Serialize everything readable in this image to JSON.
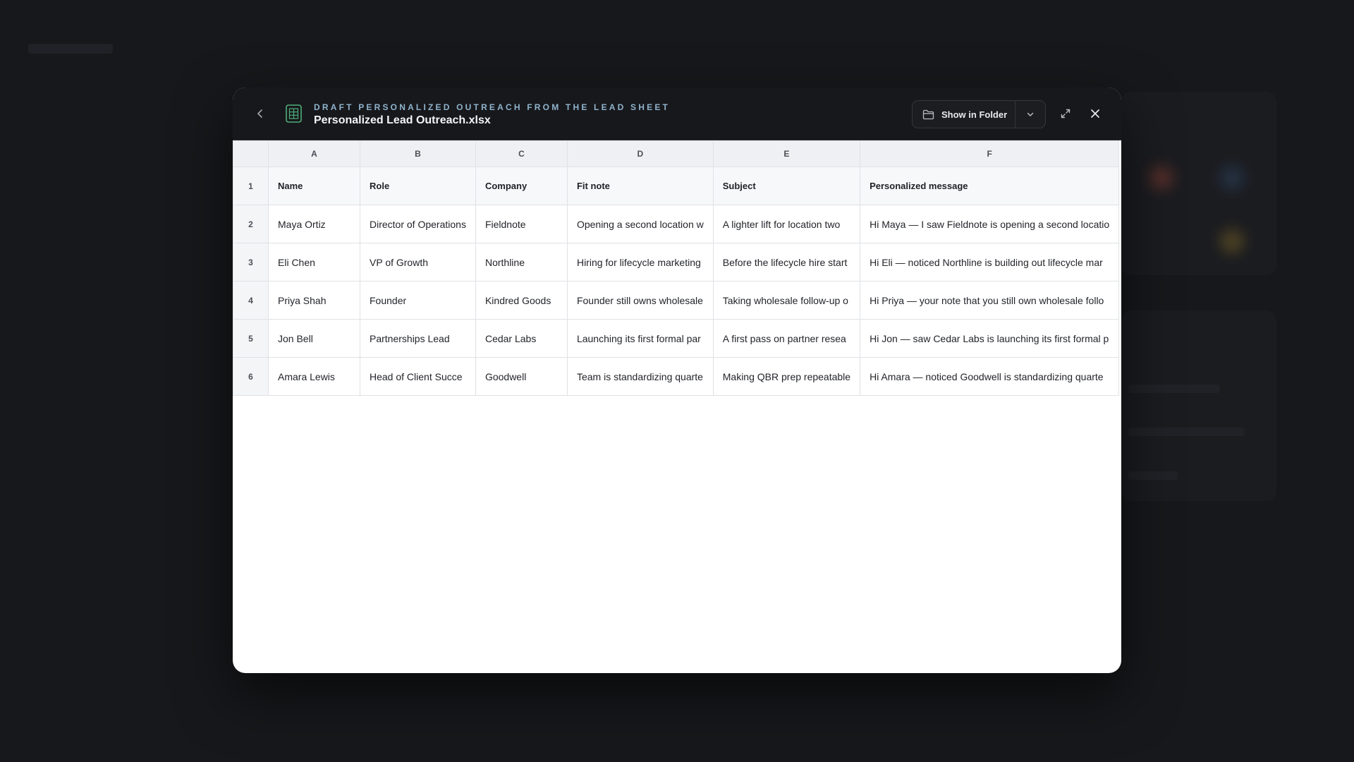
{
  "header": {
    "kicker": "DRAFT PERSONALIZED OUTREACH FROM THE LEAD SHEET",
    "title": "Personalized Lead Outreach.xlsx",
    "show_in_folder_label": "Show in Folder",
    "icons": {
      "back": "chevron-left-icon",
      "file": "spreadsheet-icon",
      "folder": "folder-icon",
      "dropdown": "chevron-down-icon",
      "expand": "expand-icon",
      "close": "close-icon"
    }
  },
  "sheet": {
    "column_letters": [
      "A",
      "B",
      "C",
      "D",
      "E",
      "F"
    ],
    "row_numbers": [
      "1",
      "2",
      "3",
      "4",
      "5",
      "6"
    ],
    "headers": [
      "Name",
      "Role",
      "Company",
      "Fit note",
      "Subject",
      "Personalized message"
    ],
    "rows": [
      [
        "Maya Ortiz",
        "Director of Operations",
        "Fieldnote",
        "Opening a second location w",
        "A lighter lift for location two",
        "Hi Maya — I saw Fieldnote is opening a second locatio"
      ],
      [
        "Eli Chen",
        "VP of Growth",
        "Northline",
        "Hiring for lifecycle marketing",
        "Before the lifecycle hire start",
        "Hi Eli — noticed Northline is building out lifecycle mar"
      ],
      [
        "Priya Shah",
        "Founder",
        "Kindred Goods",
        "Founder still owns wholesale",
        "Taking wholesale follow-up o",
        "Hi Priya — your note that you still own wholesale follo"
      ],
      [
        "Jon Bell",
        "Partnerships Lead",
        "Cedar Labs",
        "Launching its first formal par",
        "A first pass on partner resea",
        "Hi Jon — saw Cedar Labs is launching its first formal p"
      ],
      [
        "Amara Lewis",
        "Head of Client Succe",
        "Goodwell",
        "Team is standardizing quarte",
        "Making QBR prep repeatable",
        "Hi Amara — noticed Goodwell is standardizing quarte"
      ]
    ]
  },
  "colors": {
    "backdrop": "#151618",
    "header_bg": "#17181c",
    "kicker": "#8fb3cc",
    "sheet_icon": "#4fae7a"
  }
}
